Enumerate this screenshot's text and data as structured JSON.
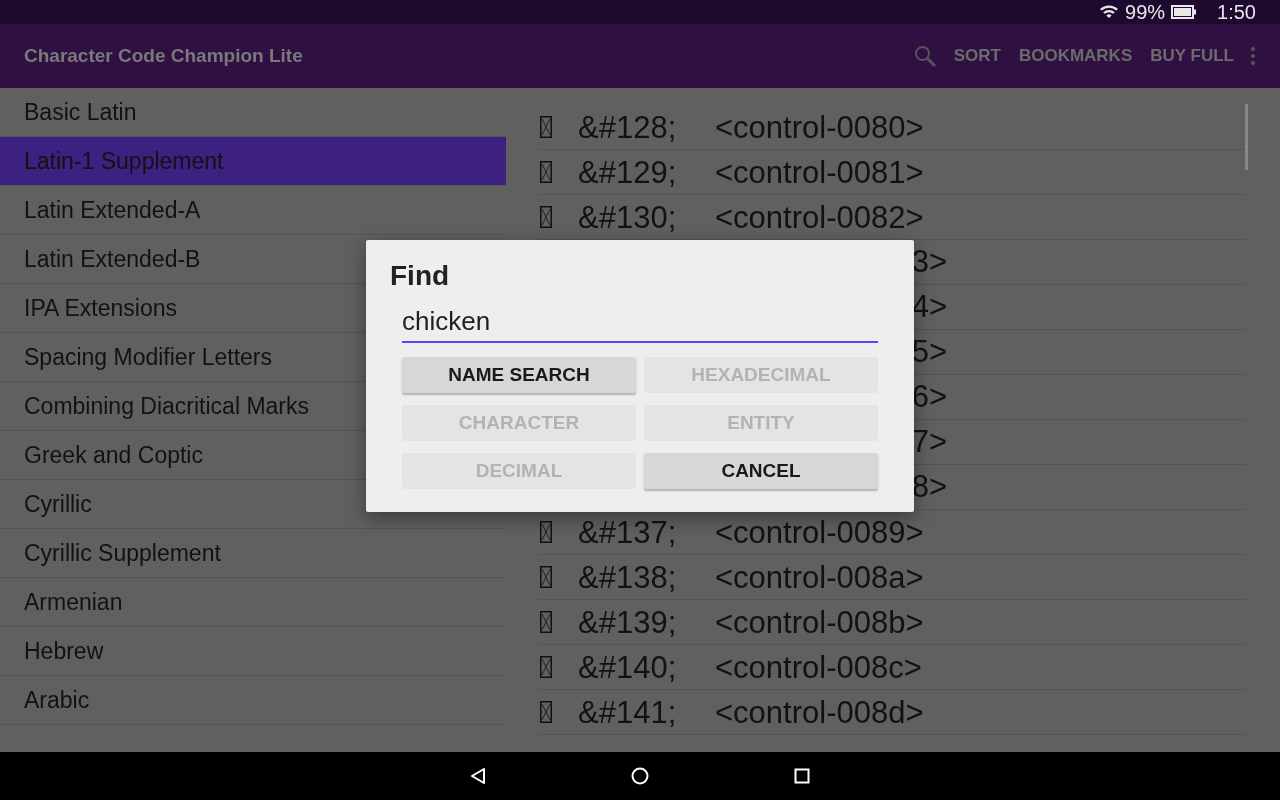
{
  "status_bar": {
    "battery": "99%",
    "time": "1:50"
  },
  "app_bar": {
    "title": "Character Code Champion Lite",
    "actions": [
      "SORT",
      "BOOKMARKS",
      "BUY FULL"
    ]
  },
  "blocks": [
    {
      "label": "Basic Latin",
      "selected": false
    },
    {
      "label": "Latin-1 Supplement",
      "selected": true
    },
    {
      "label": "Latin Extended-A",
      "selected": false
    },
    {
      "label": "Latin Extended-B",
      "selected": false
    },
    {
      "label": "IPA Extensions",
      "selected": false
    },
    {
      "label": "Spacing Modifier Letters",
      "selected": false
    },
    {
      "label": "Combining Diacritical Marks",
      "selected": false
    },
    {
      "label": "Greek and Coptic",
      "selected": false
    },
    {
      "label": "Cyrillic",
      "selected": false
    },
    {
      "label": "Cyrillic Supplement",
      "selected": false
    },
    {
      "label": "Armenian",
      "selected": false
    },
    {
      "label": "Hebrew",
      "selected": false
    },
    {
      "label": "Arabic",
      "selected": false
    }
  ],
  "characters": [
    {
      "entity": "&#128;",
      "name": "<control-0080>"
    },
    {
      "entity": "&#129;",
      "name": "<control-0081>"
    },
    {
      "entity": "&#130;",
      "name": "<control-0082>"
    },
    {
      "name_tail": "3>"
    },
    {
      "name_tail": "4>"
    },
    {
      "name_tail": "5>"
    },
    {
      "name_tail": "6>"
    },
    {
      "name_tail": "7>"
    },
    {
      "name_tail": "8>"
    },
    {
      "entity": "&#137;",
      "name": "<control-0089>"
    },
    {
      "entity": "&#138;",
      "name": "<control-008a>"
    },
    {
      "entity": "&#139;",
      "name": "<control-008b>"
    },
    {
      "entity": "&#140;",
      "name": "<control-008c>"
    },
    {
      "entity": "&#141;",
      "name": "<control-008d>"
    }
  ],
  "dialog": {
    "title": "Find",
    "input": {
      "value": "chicken"
    },
    "buttons": [
      {
        "label": "NAME SEARCH",
        "disabled": false
      },
      {
        "label": "HEXADECIMAL",
        "disabled": true
      },
      {
        "label": "CHARACTER",
        "disabled": true
      },
      {
        "label": "ENTITY",
        "disabled": true
      },
      {
        "label": "DECIMAL",
        "disabled": true
      },
      {
        "label": "CANCEL",
        "disabled": false
      }
    ]
  }
}
